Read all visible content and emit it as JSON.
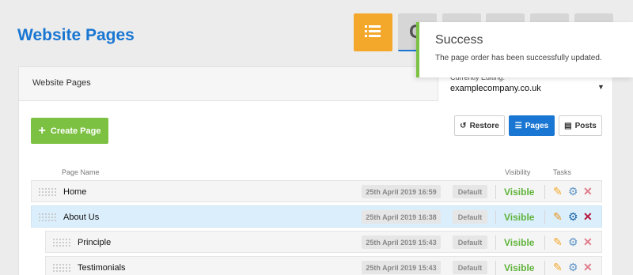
{
  "header": {
    "title": "Website Pages",
    "view_buttons": [
      {
        "icon": "list-icon",
        "state": "active",
        "color": "#f4a82b"
      },
      {
        "icon": "grid-icon",
        "state": "default"
      },
      {
        "icon": "blank",
        "state": "default"
      },
      {
        "icon": "blank",
        "state": "default"
      },
      {
        "icon": "blank",
        "state": "default"
      },
      {
        "icon": "blank",
        "state": "default"
      }
    ],
    "second_button_glyph": "C"
  },
  "panel": {
    "heading": "Website Pages",
    "currently_editing_label": "Currently Editing:",
    "currently_editing_value": "examplecompany.co.uk",
    "create_button": "Create Page",
    "restore_button": "Restore",
    "pages_button": "Pages",
    "posts_button": "Posts",
    "columns": {
      "name": "Page Name",
      "visibility": "Visibility",
      "tasks": "Tasks"
    }
  },
  "rows": [
    {
      "name": "Home",
      "date": "25th April 2019 16:59",
      "template": "Default",
      "visibility": "Visible",
      "level": 0,
      "selected": false
    },
    {
      "name": "About Us",
      "date": "25th April 2019 16:38",
      "template": "Default",
      "visibility": "Visible",
      "level": 0,
      "selected": true
    },
    {
      "name": "Principle",
      "date": "25th April 2019 15:43",
      "template": "Default",
      "visibility": "Visible",
      "level": 1,
      "selected": false
    },
    {
      "name": "Testimonials",
      "date": "25th April 2019 15:43",
      "template": "Default",
      "visibility": "Visible",
      "level": 1,
      "selected": false
    }
  ],
  "toast": {
    "title": "Success",
    "message": "The page order has been successfully updated.",
    "accent": "#7cc142"
  },
  "colors": {
    "brand_blue": "#1976d2",
    "green": "#7cc142",
    "visible_green": "#5fb33a",
    "accent_orange": "#f4a82b"
  }
}
